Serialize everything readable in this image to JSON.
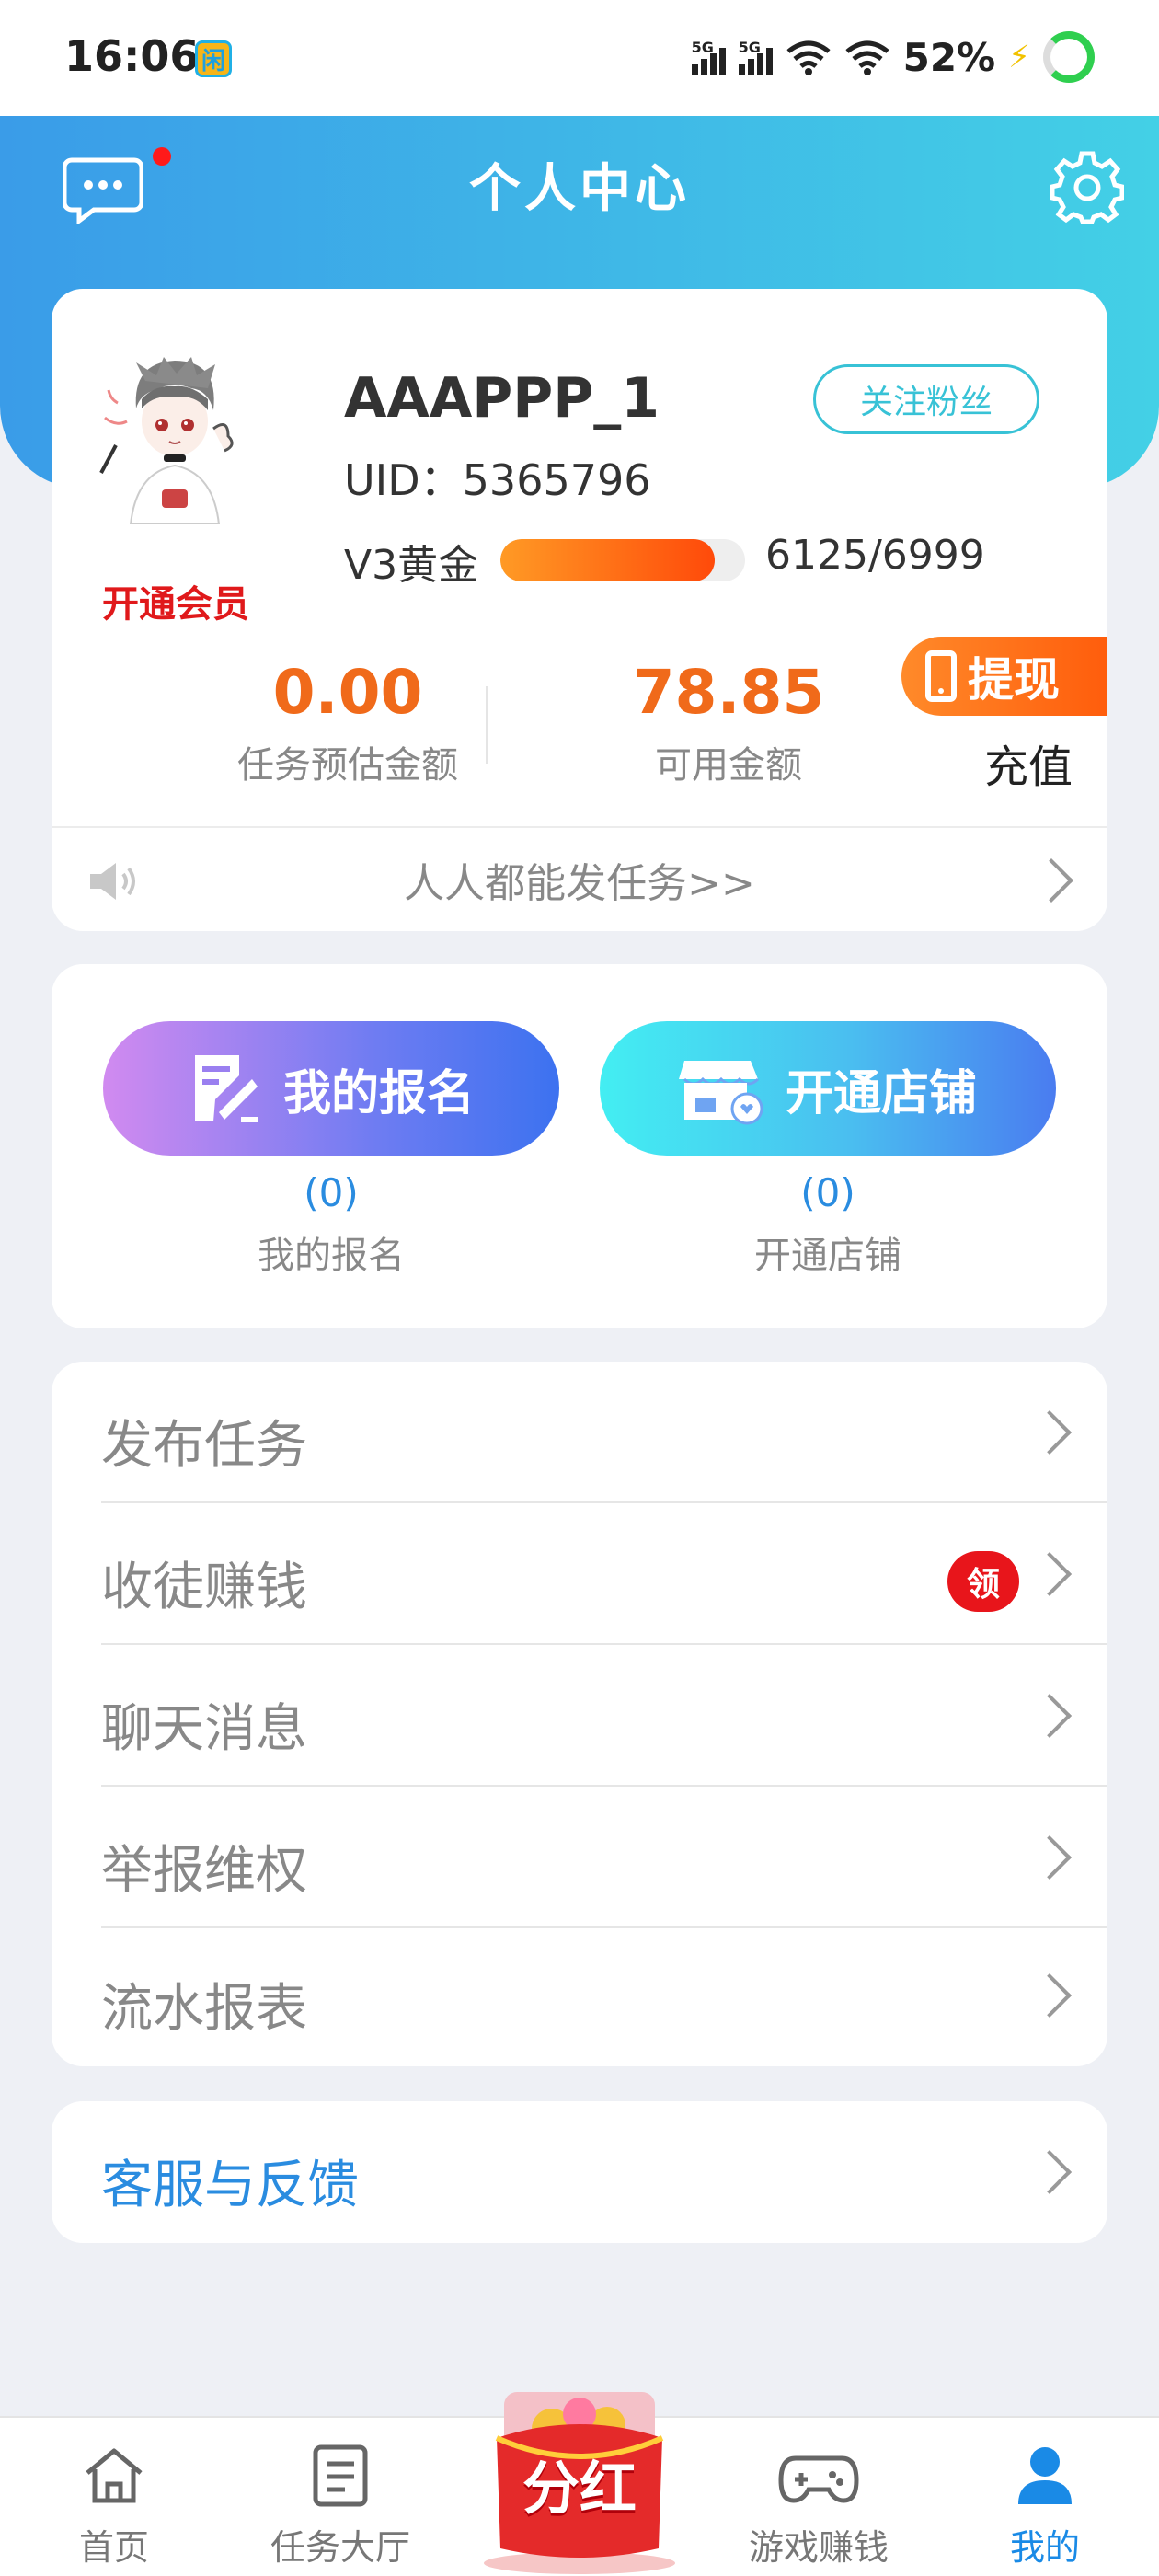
{
  "status_bar": {
    "time": "16:06",
    "app_icon_glyph": "闲",
    "signal_1_label": "5G",
    "signal_2_label": "5G",
    "battery": "52%"
  },
  "header": {
    "title": "个人中心",
    "message_icon": "chat-bubble-icon",
    "settings_icon": "gear-icon"
  },
  "profile": {
    "username": "AAAPPP_1",
    "follow_label": "关注粉丝",
    "uid": "UID：5365796",
    "vip_link": "开通会员",
    "level_label": "V3黄金",
    "level_value": "6125/6999",
    "level_progress": 0.8752,
    "stats": [
      {
        "value": "0.00",
        "label": "任务预估金额"
      },
      {
        "value": "78.85",
        "label": "可用金额"
      }
    ],
    "withdraw_label": "提现",
    "recharge_label": "充值",
    "notice": "人人都能发任务>>"
  },
  "actions": [
    {
      "label": "我的报名",
      "count": "(0)",
      "caption": "我的报名"
    },
    {
      "label": "开通店铺",
      "count": "(0)",
      "caption": "开通店铺"
    }
  ],
  "menu": [
    {
      "label": "发布任务"
    },
    {
      "label": "收徒赚钱",
      "badge": "领"
    },
    {
      "label": "聊天消息"
    },
    {
      "label": "举报维权"
    },
    {
      "label": "流水报表"
    }
  ],
  "service": {
    "label": "客服与反馈"
  },
  "tabbar": [
    {
      "label": "首页",
      "icon": "home-icon"
    },
    {
      "label": "任务大厅",
      "icon": "task-list-icon"
    },
    {
      "label": "分红",
      "icon": "red-envelope-icon"
    },
    {
      "label": "游戏赚钱",
      "icon": "gamepad-icon"
    },
    {
      "label": "我的",
      "icon": "user-icon",
      "active": true
    }
  ],
  "colors": {
    "header_start": "#3a9ce8",
    "header_end": "#43d0e6",
    "accent_orange": "#f06a1a",
    "link_blue": "#2a8ce0",
    "badge_red": "#e8151b"
  }
}
